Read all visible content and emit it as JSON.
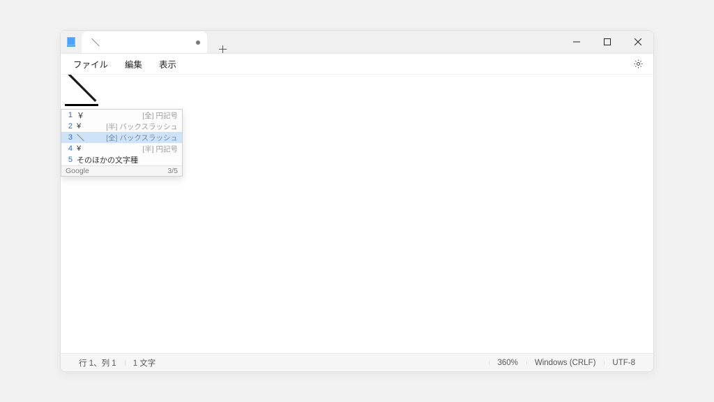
{
  "window": {
    "tab_title": "＼",
    "dirty": true
  },
  "menubar": {
    "file": "ファイル",
    "edit": "編集",
    "view": "表示"
  },
  "editor": {
    "composition_text": "＼"
  },
  "ime": {
    "rows": [
      {
        "index": "1",
        "candidate": "￥",
        "description": "[全] 円記号"
      },
      {
        "index": "2",
        "candidate": "¥",
        "description": "[半] バックスラッシュ"
      },
      {
        "index": "3",
        "candidate": "＼",
        "description": "[全] バックスラッシュ"
      },
      {
        "index": "4",
        "candidate": "¥",
        "description": "[半] 円記号"
      },
      {
        "index": "5",
        "candidate": "そのほかの文字種",
        "description": ""
      }
    ],
    "selected_index": 2,
    "footer_left": "Google",
    "footer_right": "3/5"
  },
  "statusbar": {
    "position": "行 1、列 1",
    "charcount": "1 文字",
    "zoom": "360%",
    "line_ending": "Windows (CRLF)",
    "encoding": "UTF-8"
  }
}
